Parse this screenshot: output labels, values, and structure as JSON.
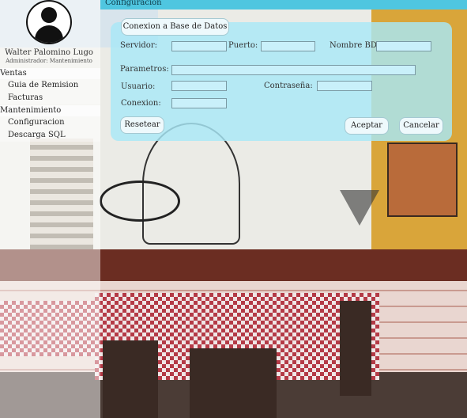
{
  "sidebar": {
    "user_name": "Walter Palomino Lugo",
    "user_role": "Administrador: Mantenimiento",
    "groups": [
      {
        "title": "Ventas",
        "items": [
          "Guia de Remision",
          "Facturas"
        ]
      },
      {
        "title": "Mantenimiento",
        "items": [
          "Configuracion",
          "Descarga SQL"
        ]
      }
    ]
  },
  "header": {
    "title": "Configuracion"
  },
  "form": {
    "conexion_bd_button": "Conexion a Base de Datos",
    "servidor_label": "Servidor:",
    "servidor_value": "",
    "puerto_label": "Puerto:",
    "puerto_value": "",
    "nombre_bd_label": "Nombre BD:",
    "nombre_bd_value": "",
    "parametros_label": "Parametros:",
    "parametros_value": "",
    "usuario_label": "Usuario:",
    "usuario_value": "",
    "contrasena_label": "Contraseña:",
    "contrasena_value": "",
    "conexion_label": "Conexion:",
    "conexion_value": "",
    "reset_button": "Resetear",
    "accept_button": "Aceptar",
    "cancel_button": "Cancelar"
  },
  "colors": {
    "header_bar": "#4fc6e0",
    "panel": "#a8e8f6",
    "input_fill": "#c9f0fa"
  }
}
